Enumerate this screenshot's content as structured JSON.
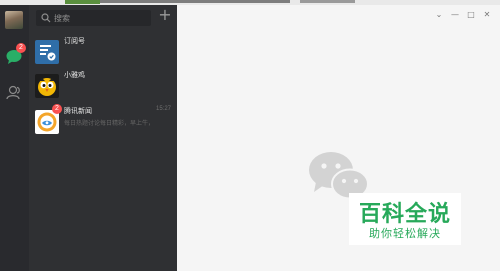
{
  "colors": {
    "rail_bg": "#292a2e",
    "list_bg": "#2f3033",
    "main_bg": "#f5f5f5",
    "badge": "#fa5151",
    "wechat_green": "#2aae67",
    "watermark_green": "#27a95a"
  },
  "sidebar": {
    "chat_badge": "2",
    "icons": [
      "avatar",
      "chat-icon",
      "contacts-icon"
    ]
  },
  "search": {
    "placeholder": "搜索",
    "add_label": "+"
  },
  "conversations": [
    {
      "name": "订阅号",
      "icon": "subscription-icon"
    },
    {
      "name": "小雅鸡",
      "icon": "bird-avatar"
    },
    {
      "name": "腾讯新闻",
      "icon": "tencent-news-icon",
      "time": "15:27",
      "preview": "每日热题讨论每日精彩，早上牛，",
      "badge": "2"
    }
  ],
  "window_controls": {
    "menu": "⌄",
    "minimize": "—",
    "maximize": "□",
    "close": "✕"
  },
  "watermark": {
    "title": "百科全说",
    "subtitle": "助你轻松解决"
  }
}
